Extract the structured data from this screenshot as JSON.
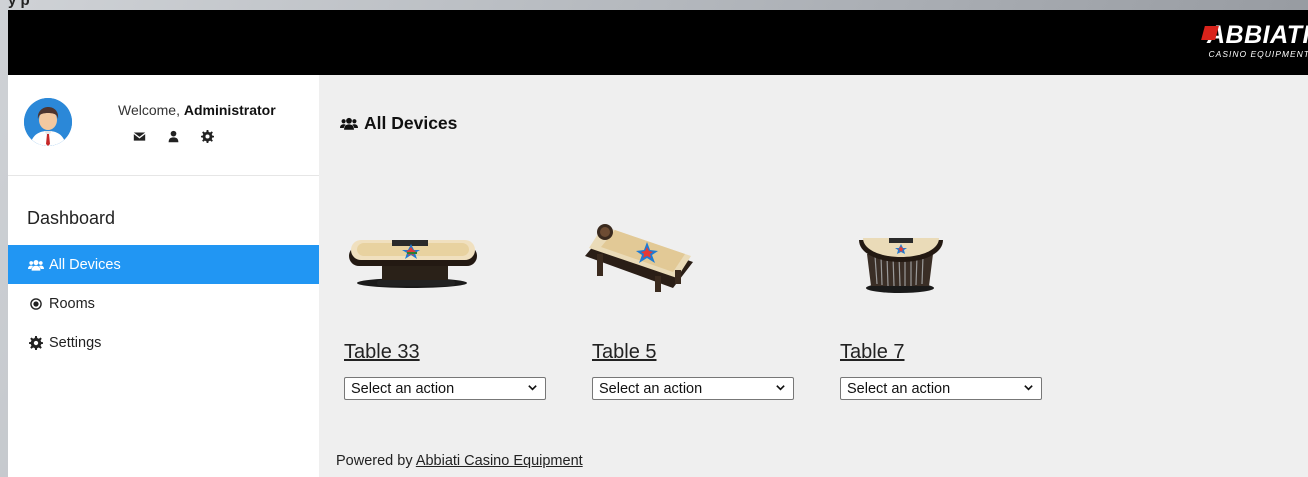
{
  "window_strip": {
    "text": "y p"
  },
  "brand": {
    "name": "ABBIATI",
    "subtitle": "CASINO EQUIPMENT",
    "accent": "#d9231b"
  },
  "sidebar": {
    "welcome_prefix": "Welcome, ",
    "user": "Administrator",
    "profile_icons": [
      "envelope-icon",
      "user-icon",
      "gear-icon"
    ],
    "section_title": "Dashboard",
    "items": [
      {
        "label": "All Devices",
        "icon": "users-icon",
        "active": true
      },
      {
        "label": "Rooms",
        "icon": "radio-dot-icon",
        "active": false
      },
      {
        "label": "Settings",
        "icon": "gear-icon",
        "active": false
      }
    ],
    "active_color": "#2196f3"
  },
  "main": {
    "title": "All Devices",
    "devices": [
      {
        "name": "Table 33",
        "action_placeholder": "Select an action",
        "image": "oval-table"
      },
      {
        "name": "Table 5",
        "action_placeholder": "Select an action",
        "image": "roulette-table"
      },
      {
        "name": "Table 7",
        "action_placeholder": "Select an action",
        "image": "half-moon-table"
      }
    ],
    "footer_prefix": "Powered by ",
    "footer_link": "Abbiati Casino Equipment"
  }
}
